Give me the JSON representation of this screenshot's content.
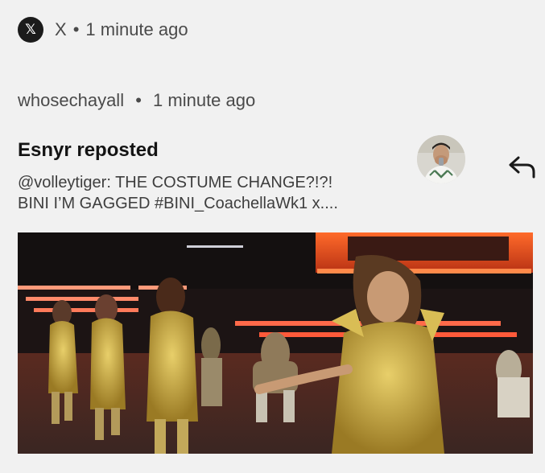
{
  "header": {
    "app_logo": "x-logo-icon",
    "app_logo_glyph": "𝕏",
    "app_name": "X",
    "separator": "•",
    "time": "1 minute ago"
  },
  "subheader": {
    "account": "whosechayall",
    "separator": "•",
    "time": "1 minute ago"
  },
  "notification": {
    "title": "Esnyr reposted",
    "body_line1": "@volleytiger: THE COSTUME CHANGE?!?!",
    "body_line2": "BINI I’M GAGGED #BINI_CoachellaWk1 x....",
    "avatar_icon": "user-avatar",
    "reply_icon": "reply-arrow-icon"
  },
  "media": {
    "type": "concert-photo",
    "description_icon": "stage-performance-image"
  },
  "colors": {
    "background": "#f1f1f1",
    "text_primary": "#141414",
    "text_secondary": "#4a4a4a",
    "stage_red": "#e0431f",
    "costume_gold": "#c9a93a"
  }
}
